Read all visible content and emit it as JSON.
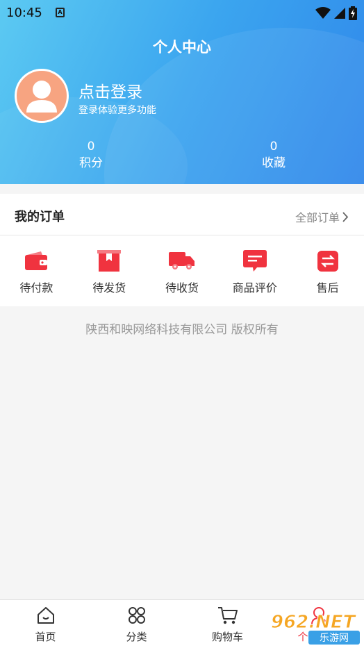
{
  "status_bar": {
    "time": "10:45",
    "a_icon": "A"
  },
  "header": {
    "title": "个人中心",
    "login_title": "点击登录",
    "login_subtitle": "登录体验更多功能",
    "stats": [
      {
        "value": "0",
        "label": "积分"
      },
      {
        "value": "0",
        "label": "收藏"
      }
    ]
  },
  "orders": {
    "title": "我的订单",
    "all_label": "全部订单",
    "items": [
      {
        "label": "待付款",
        "icon": "wallet-icon"
      },
      {
        "label": "待发货",
        "icon": "package-icon"
      },
      {
        "label": "待收货",
        "icon": "truck-icon"
      },
      {
        "label": "商品评价",
        "icon": "comment-icon"
      },
      {
        "label": "售后",
        "icon": "exchange-icon"
      }
    ]
  },
  "copyright": "陕西和映网络科技有限公司 版权所有",
  "tabbar": {
    "items": [
      {
        "label": "首页",
        "icon": "home-icon"
      },
      {
        "label": "分类",
        "icon": "grid-icon"
      },
      {
        "label": "购物车",
        "icon": "cart-icon"
      },
      {
        "label": "个人中心",
        "icon": "user-icon"
      }
    ]
  },
  "watermark": {
    "brand": "962.NET",
    "site": "乐游网"
  },
  "colors": {
    "accent_red": "#f0333f",
    "header_start": "#5ccaf2",
    "header_end": "#2f86ea",
    "avatar_bg": "#f7a481"
  }
}
